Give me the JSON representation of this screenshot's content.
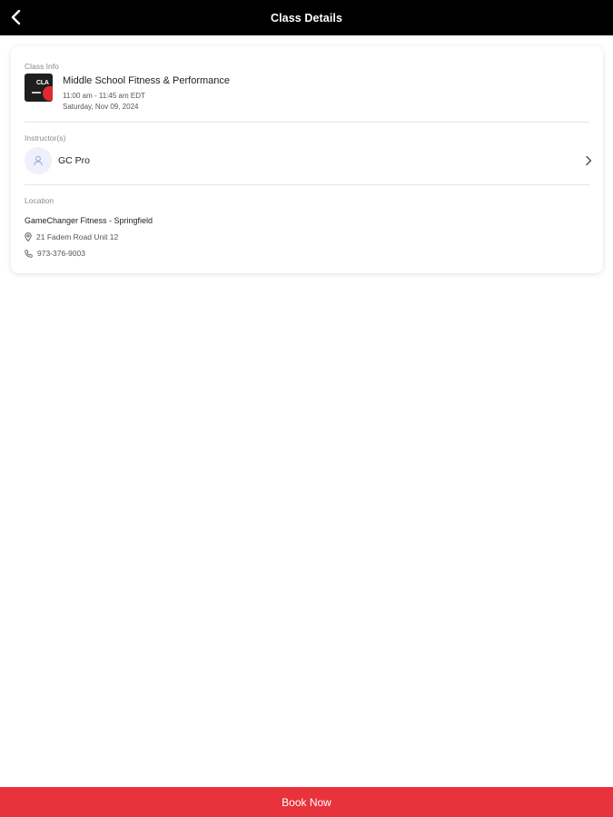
{
  "header": {
    "title": "Class Details",
    "back_icon": "chevron-left-icon"
  },
  "class_info": {
    "section_label": "Class Info",
    "thumbnail_text": "CLA",
    "title": "Middle School Fitness & Performance",
    "time": "11:00 am - 11:45 am EDT",
    "date": "Saturday, Nov 09, 2024"
  },
  "instructors": {
    "section_label": "Instructor(s)",
    "name": "GC Pro",
    "avatar_icon": "user-icon",
    "chevron_icon": "chevron-right-icon"
  },
  "location": {
    "section_label": "Location",
    "name": "GameChanger Fitness - Springfield",
    "address": "21 Fadem Road Unit 12",
    "phone": "973-376-9003",
    "address_icon": "map-pin-icon",
    "phone_icon": "phone-icon"
  },
  "footer": {
    "book_label": "Book Now"
  },
  "colors": {
    "header_bg": "#000000",
    "accent": "#e8323c",
    "avatar_bg": "#eef0fb"
  }
}
